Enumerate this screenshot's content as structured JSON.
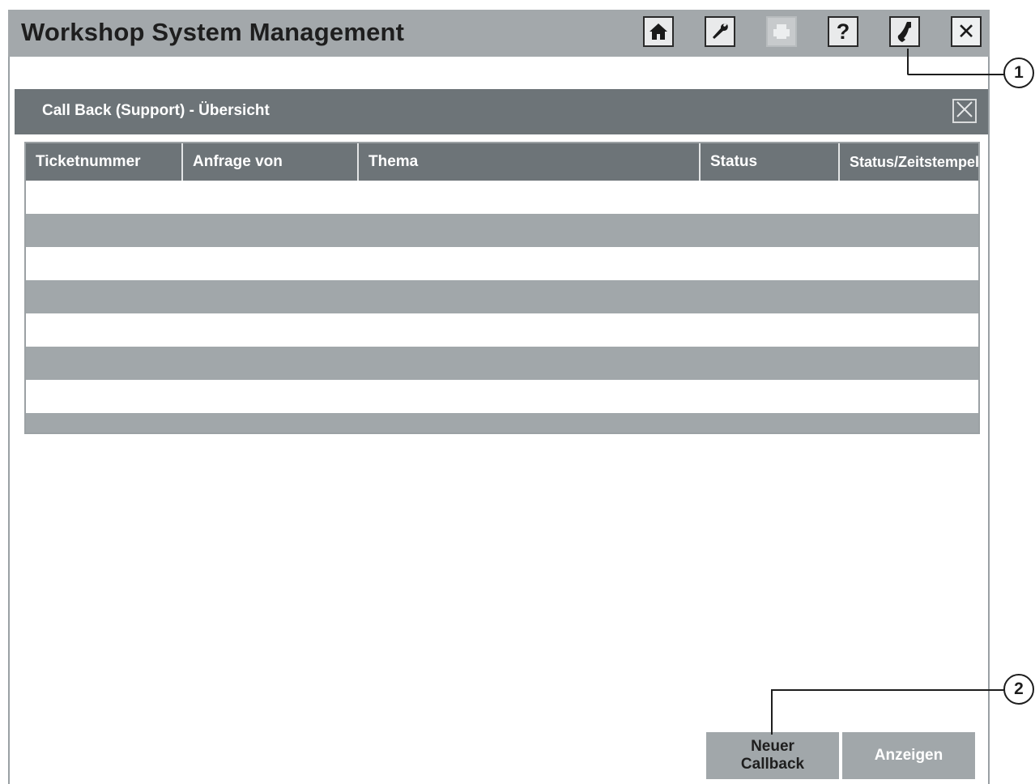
{
  "app": {
    "title": "Workshop System Management"
  },
  "toolbar": {
    "buttons": [
      {
        "icon": "home-icon",
        "state": "enabled"
      },
      {
        "icon": "wrench-icon",
        "state": "enabled"
      },
      {
        "icon": "printer-icon",
        "state": "disabled"
      },
      {
        "icon": "help-icon",
        "label": "?",
        "state": "enabled"
      },
      {
        "icon": "phone-icon",
        "state": "enabled"
      },
      {
        "icon": "close-icon",
        "label": "✕",
        "state": "enabled"
      }
    ]
  },
  "dialog": {
    "title": "Call Back (Support) - Übersicht",
    "close_icon": "close-icon",
    "table": {
      "columns": [
        "Ticketnummer",
        "Anfrage von",
        "Thema",
        "Status",
        "Status/Zeitstempel"
      ],
      "rows": []
    },
    "buttons": {
      "new_callback_line1": "Neuer",
      "new_callback_line2": "Callback",
      "show": "Anzeigen"
    }
  },
  "callouts": [
    "1",
    "2"
  ],
  "colors": {
    "titlebar": "#a3a8ab",
    "header": "#6d7478",
    "alt_row": "#a1a7aa"
  }
}
